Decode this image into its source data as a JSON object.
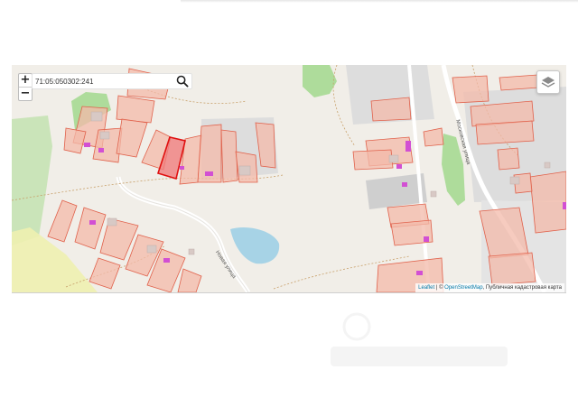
{
  "search": {
    "value": "71:05:050302:241"
  },
  "zoom": {
    "in_label": "+",
    "out_label": "−"
  },
  "map": {
    "streets": [
      "Новая улица",
      "Московская улица"
    ],
    "colors": {
      "land": "#f1eee8",
      "parcel_fill": "#f3b9a9",
      "parcel_stroke": "#e0604a",
      "selected_fill": "#f07d7d",
      "selected_stroke": "#e01010",
      "building": "#d8c9c5",
      "cadastre_marker": "#d24fd3",
      "green": "#aedc9b",
      "water": "#a7d3e6",
      "track": "#c8a06a"
    }
  },
  "attribution": {
    "leaflet": "Leaflet",
    "separator": "| ©",
    "osm": "OpenStreetMap",
    "cadastre": ", Публичная кадастровая карта"
  },
  "icons": [
    "plus-icon",
    "minus-icon",
    "search-icon",
    "layers-icon"
  ]
}
